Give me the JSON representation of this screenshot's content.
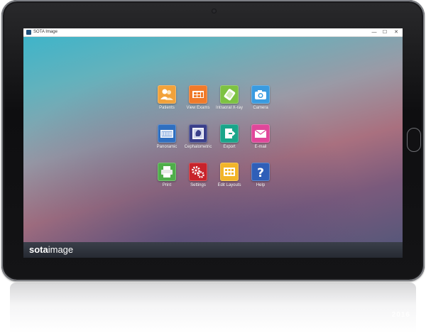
{
  "window": {
    "title": "SOTA Image",
    "controls": {
      "minimize": "—",
      "maximize": "☐",
      "close": "✕"
    }
  },
  "tiles": [
    {
      "label": "Patients",
      "icon": "patients-icon",
      "color": "#f2a23a"
    },
    {
      "label": "View Exams",
      "icon": "view-exams-icon",
      "color": "#f07a2a"
    },
    {
      "label": "Intraoral X-ray",
      "icon": "intraoral-xray-icon",
      "color": "#7dc242"
    },
    {
      "label": "Camera",
      "icon": "camera-icon",
      "color": "#3a9be0"
    },
    {
      "label": "Panoramic",
      "icon": "panoramic-icon",
      "color": "#2f6fc0"
    },
    {
      "label": "Cephalometric",
      "icon": "cephalometric-icon",
      "color": "#3a3f8a"
    },
    {
      "label": "Export",
      "icon": "export-icon",
      "color": "#1aa58a"
    },
    {
      "label": "E-mail",
      "icon": "email-icon",
      "color": "#e0479a"
    },
    {
      "label": "Print",
      "icon": "print-icon",
      "color": "#4fae4a"
    },
    {
      "label": "Settings",
      "icon": "settings-icon",
      "color": "#c8232b"
    },
    {
      "label": "Edit Layouts",
      "icon": "edit-layouts-icon",
      "color": "#f2b52a"
    },
    {
      "label": "Help",
      "icon": "help-icon",
      "color": "#2f5fb8"
    }
  ],
  "brand": {
    "part1": "sota",
    "part2": "image"
  },
  "reflection_text": "2016"
}
